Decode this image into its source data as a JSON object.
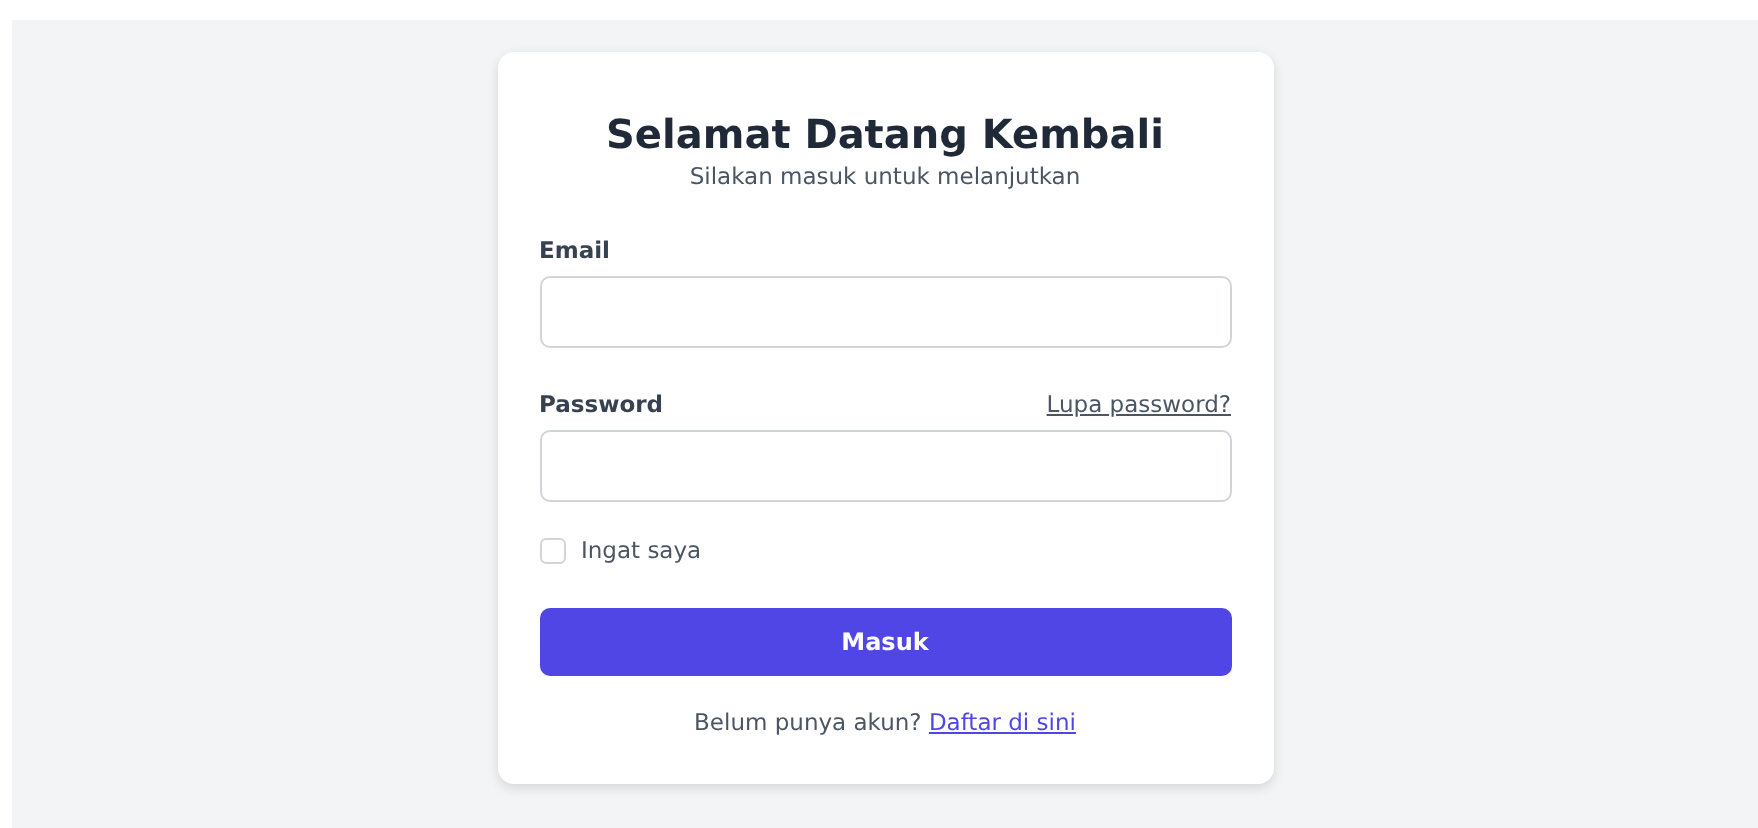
{
  "title": "Selamat Datang Kembali",
  "subtitle": "Silakan masuk untuk melanjutkan",
  "fields": [
    {
      "label": "Email"
    },
    {
      "label": "Password",
      "link": "Lupa password?"
    }
  ],
  "remember": {
    "label": "Ingat saya",
    "checked": false
  },
  "submit": "Masuk",
  "footer": {
    "text": "Belum punya akun?",
    "link": "Daftar di sini"
  }
}
